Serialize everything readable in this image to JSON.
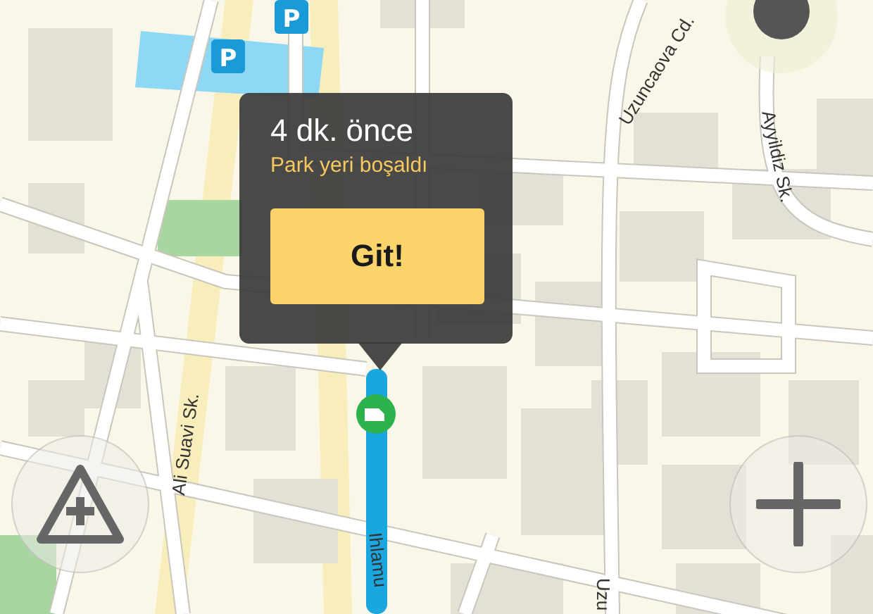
{
  "popup": {
    "title": "4 dk. önce",
    "subtitle": "Park yeri boşaldı",
    "button": "Git!"
  },
  "parking_signs": [
    {
      "label": "P"
    },
    {
      "label": "P"
    }
  ],
  "street_labels": [
    {
      "text": "Uzuncaova Cd."
    },
    {
      "text": "Ayyildiz Sk."
    },
    {
      "text": "Ali Suavi Sk."
    },
    {
      "text": "Ihlamu"
    },
    {
      "text": "Uzu"
    }
  ]
}
